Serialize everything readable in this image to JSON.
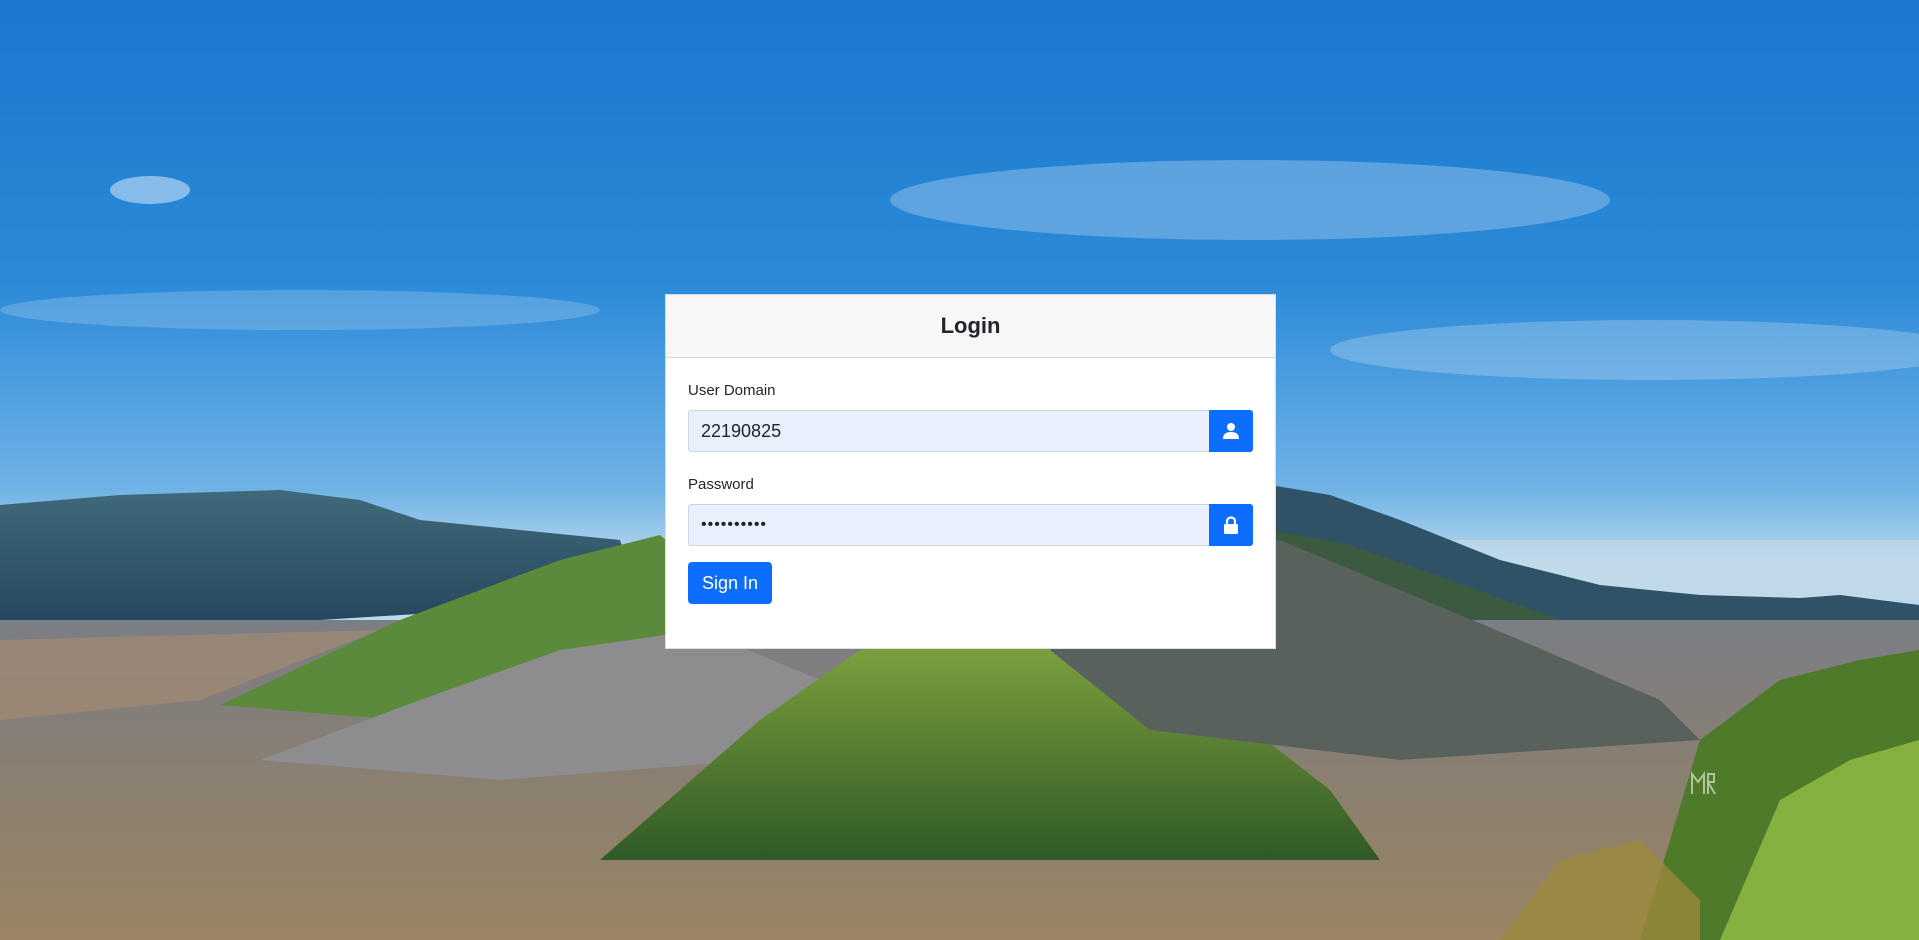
{
  "login": {
    "title": "Login",
    "user_domain_label": "User Domain",
    "user_domain_value": "22190825",
    "password_label": "Password",
    "password_value": "••••••••••",
    "sign_in_label": "Sign In"
  },
  "icons": {
    "user": "user-icon",
    "lock": "lock-icon"
  },
  "colors": {
    "primary": "#0d6efd",
    "input_autofill": "#e8f0fe",
    "header_bg": "#f7f7f7"
  }
}
